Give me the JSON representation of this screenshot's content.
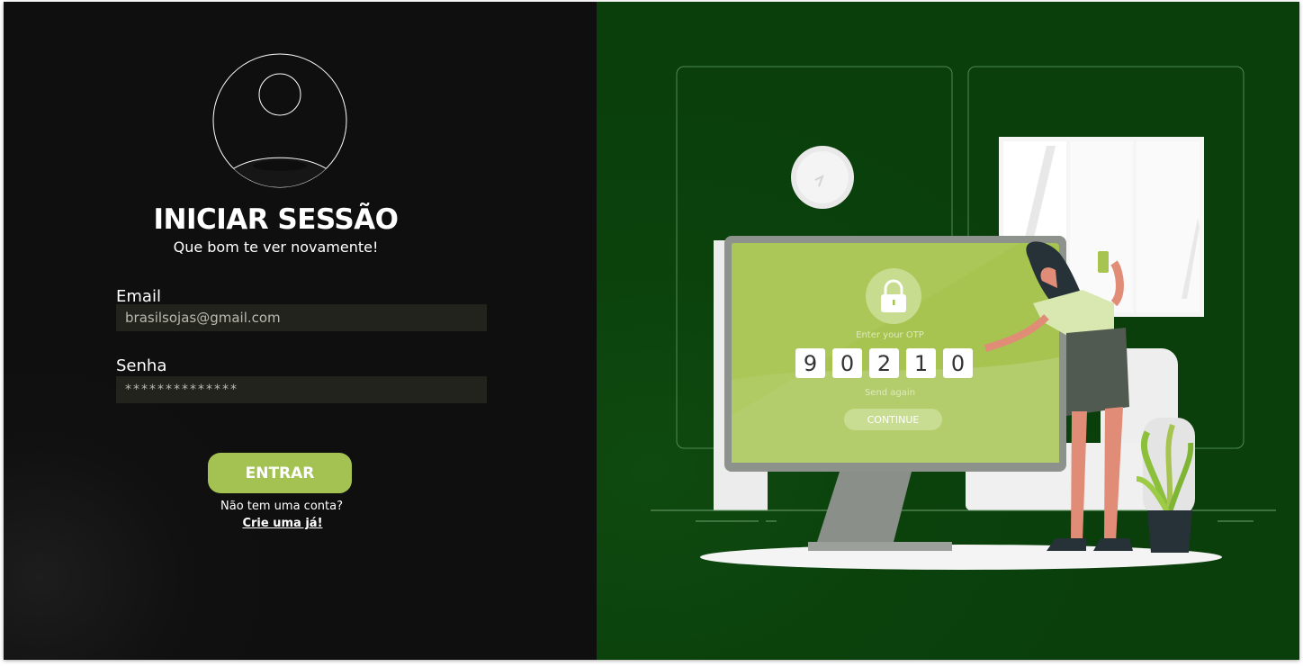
{
  "login": {
    "title": "INICIAR SESSÃO",
    "subtitle": "Que bom te ver novamente!",
    "email_label": "Email",
    "email_value": "brasilsojas@gmail.com",
    "password_label": "Senha",
    "password_value": "**************",
    "submit_label": "ENTRAR",
    "no_account_text": "Não tem uma conta?",
    "signup_link": "Crie uma já!"
  },
  "illustration": {
    "otp_label": "Enter your OTP",
    "otp_digits": [
      "9",
      "0",
      "2",
      "1",
      "0"
    ],
    "send_again": "Send again",
    "continue_label": "CONTINUE"
  },
  "colors": {
    "left_bg": "#111111",
    "right_bg": "#0b420c",
    "accent": "#a3c251",
    "field_bg": "#23231d"
  },
  "icons": [
    "user-avatar-icon",
    "lock-icon"
  ]
}
